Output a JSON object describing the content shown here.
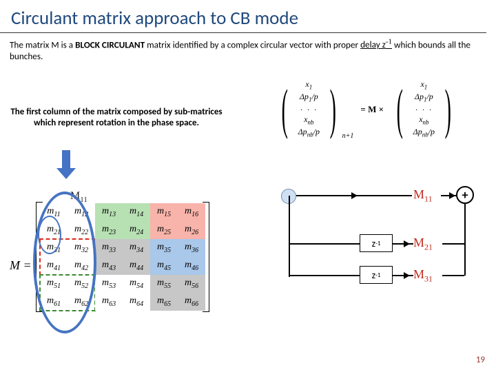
{
  "title": "Circulant matrix approach to CB mode",
  "para_parts": {
    "p1": "The matrix M is a ",
    "bold": "BLOCK CIRCULANT",
    "p2": " matrix identified by a complex circular vector with proper ",
    "delay_u": "delay z",
    "delay_sup": "-1",
    "p3": " which bounds all the bunches."
  },
  "caption": "The first column of the matrix composed by sub-matrices which represent rotation in the phase space.",
  "vec": {
    "leading": "(",
    "row1": "x",
    "row1s": "1",
    "row2a": "Δp",
    "row2s": "1",
    "row2b": "/p",
    "dots": "· · ·",
    "row3": "x",
    "row3s": "nb",
    "row4a": "Δp",
    "row4s": "nb",
    "row4b": "/p",
    "subscript": "n+1",
    "eq": "= M ×",
    "openParen": "(",
    "closeParen": ")"
  },
  "M_label": "M =",
  "headers": {
    "h11": "M",
    "h11s": "11"
  },
  "cells": {
    "a": [
      "m11",
      "m12",
      "m21",
      "m22",
      "m31",
      "m32",
      "m41",
      "m42",
      "m51",
      "m52",
      "m61",
      "m62"
    ],
    "b": [
      "m13",
      "m14",
      "m23",
      "m24",
      "m33",
      "m34",
      "m43",
      "m44",
      "m53",
      "m54",
      "m63",
      "m64"
    ],
    "c": [
      "m15",
      "m16",
      "m25",
      "m26",
      "m35",
      "m36",
      "m45",
      "m46",
      "m55",
      "m56",
      "m65",
      "m66"
    ]
  },
  "right": {
    "M11": "M",
    "M11s": "11",
    "M21": "M",
    "M21s": "21",
    "M31": "M",
    "M31s": "31",
    "z": "z",
    "zs": "-1",
    "plus": "+"
  },
  "pagenum": "19"
}
